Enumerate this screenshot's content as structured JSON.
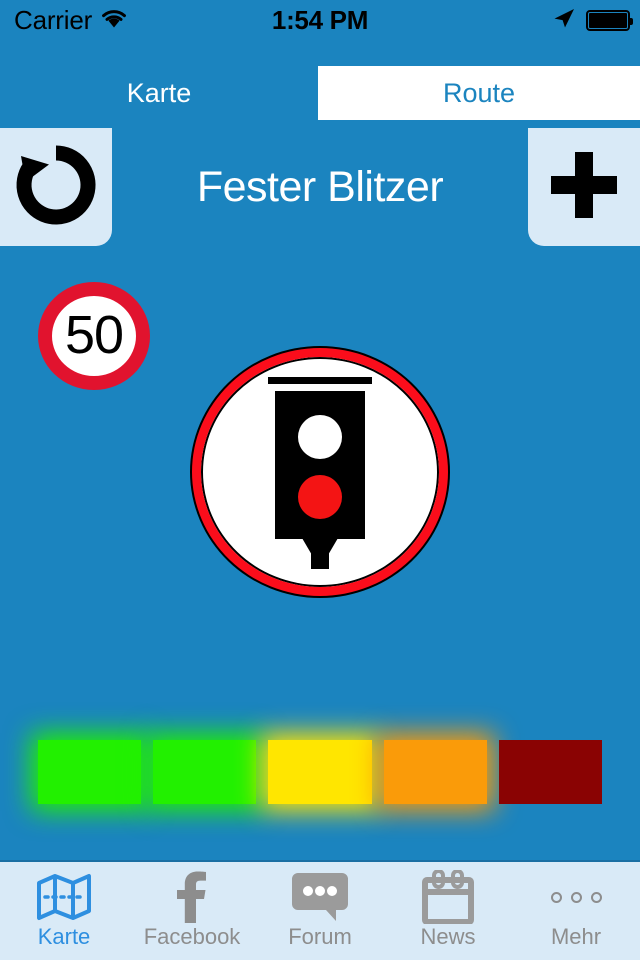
{
  "status_bar": {
    "carrier": "Carrier",
    "wifi_icon": "wifi-icon",
    "time": "1:54 PM",
    "location_icon": "location-arrow-icon",
    "battery_icon": "battery-full-icon"
  },
  "segmented_control": {
    "selected": "Karte",
    "options": [
      {
        "label": "Karte",
        "selected": true
      },
      {
        "label": "Route",
        "selected": false
      }
    ]
  },
  "title_bar": {
    "title": "Fester Blitzer",
    "undo_icon": "undo-arrow-icon",
    "add_icon": "plus-icon"
  },
  "content": {
    "speed_limit": {
      "value": "50",
      "icon": "speed-limit-sign-icon"
    },
    "hazard_icon": "fixed-speed-camera-icon",
    "rating_blocks": [
      {
        "index": 1,
        "color": "#22f000",
        "glow": true
      },
      {
        "index": 2,
        "color": "#22f000",
        "glow": true
      },
      {
        "index": 3,
        "color": "#ffe600",
        "glow": true
      },
      {
        "index": 4,
        "color": "#fa9b09",
        "glow": true
      },
      {
        "index": 5,
        "color": "#8a0303",
        "glow": false
      }
    ]
  },
  "tab_bar": {
    "tabs": [
      {
        "label": "Karte",
        "icon": "map-icon",
        "active": true
      },
      {
        "label": "Facebook",
        "icon": "facebook-icon",
        "active": false
      },
      {
        "label": "Forum",
        "icon": "chat-bubble-icon",
        "active": false
      },
      {
        "label": "News",
        "icon": "calendar-icon",
        "active": false
      },
      {
        "label": "Mehr",
        "icon": "more-dots-icon",
        "active": false
      }
    ]
  },
  "colors": {
    "background_blue": "#1b84bf",
    "panel_light_blue": "#d9eaf7",
    "accent_blue": "#2e8fe0",
    "sign_red": "#e1132e",
    "icon_gray": "#8d8d8d"
  }
}
